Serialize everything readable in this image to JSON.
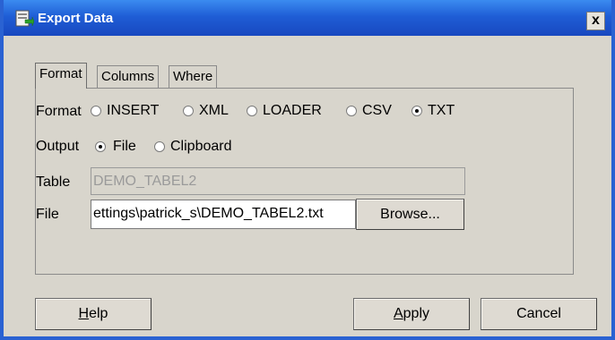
{
  "window": {
    "title": "Export Data",
    "close_label": "x",
    "icon": "database-export-icon"
  },
  "tabs": [
    {
      "label": "Format",
      "active": true
    },
    {
      "label": "Columns",
      "active": false
    },
    {
      "label": "Where",
      "active": false
    }
  ],
  "format": {
    "label": "Format",
    "options": [
      "INSERT",
      "XML",
      "LOADER",
      "CSV",
      "TXT"
    ],
    "selected": "TXT"
  },
  "output": {
    "label": "Output",
    "options": [
      "File",
      "Clipboard"
    ],
    "selected": "File"
  },
  "table": {
    "label": "Table",
    "value": "DEMO_TABEL2"
  },
  "file": {
    "label": "File",
    "value": "ettings\\patrick_s\\DEMO_TABEL2.txt",
    "browse_label": "Browse..."
  },
  "buttons": {
    "help_accel": "H",
    "help_rest": "elp",
    "apply_accel": "A",
    "apply_rest": "pply",
    "cancel": "Cancel"
  },
  "colors": {
    "titlebar": "#1f5ed6",
    "dialog_bg": "#d8d5cc",
    "disabled_text": "#9a9a9a"
  }
}
